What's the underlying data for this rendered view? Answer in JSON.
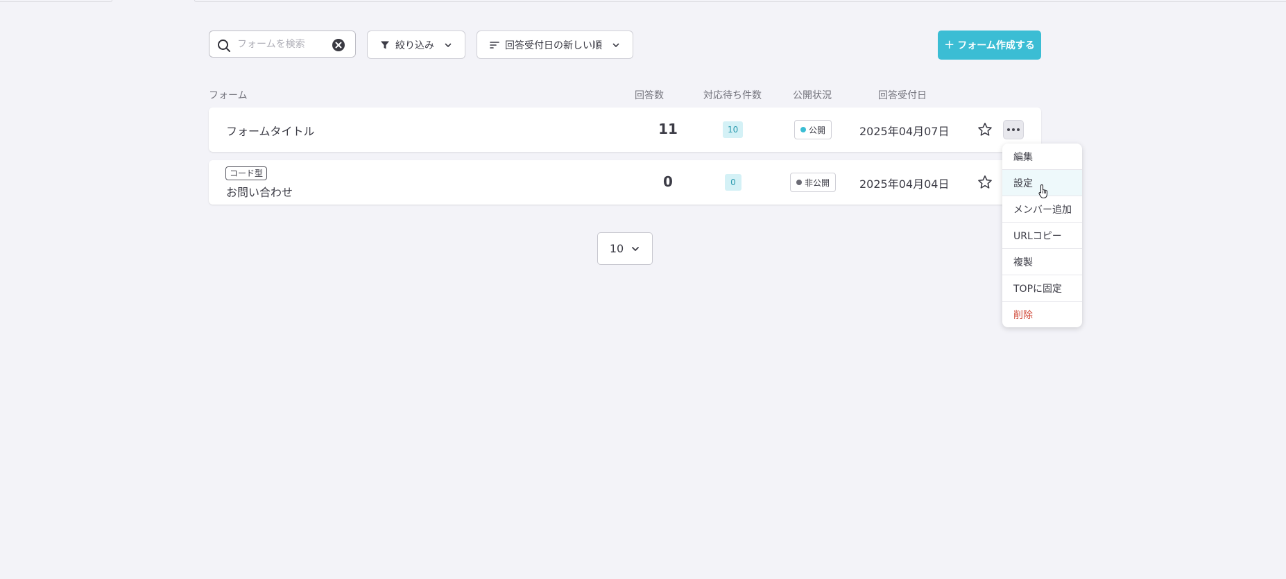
{
  "toolbar": {
    "search_placeholder": "フォームを検索",
    "search_value": "",
    "filter_label": "絞り込み",
    "sort_label": "回答受付日の新しい順",
    "create_label": "フォーム作成する",
    "create_prefix": "+"
  },
  "table": {
    "headers": {
      "form": "フォーム",
      "responses": "回答数",
      "pending": "対応待ち件数",
      "status": "公開状況",
      "date": "回答受付日"
    },
    "rows": [
      {
        "tag": "",
        "title": "フォームタイトル",
        "responses": "11",
        "pending": "10",
        "status": "公開",
        "status_color": "#3bbdd4",
        "date": "2025年04月07日",
        "starred": false
      },
      {
        "tag": "コード型",
        "title": "お問い合わせ",
        "responses": "0",
        "pending": "0",
        "status": "非公開",
        "status_color": "#6b6b74",
        "date": "2025年04月04日",
        "starred": false
      }
    ]
  },
  "pagination": {
    "per_page": "10"
  },
  "row_menu": {
    "items": [
      {
        "label": "編集"
      },
      {
        "label": "設定"
      },
      {
        "label": "メンバー追加"
      },
      {
        "label": "URLコピー"
      },
      {
        "label": "複製"
      },
      {
        "label": "TOPに固定"
      },
      {
        "label": "削除"
      }
    ]
  },
  "colors": {
    "accent": "#3bbdd4",
    "danger": "#d04a3a",
    "background": "#f3f3f8"
  }
}
